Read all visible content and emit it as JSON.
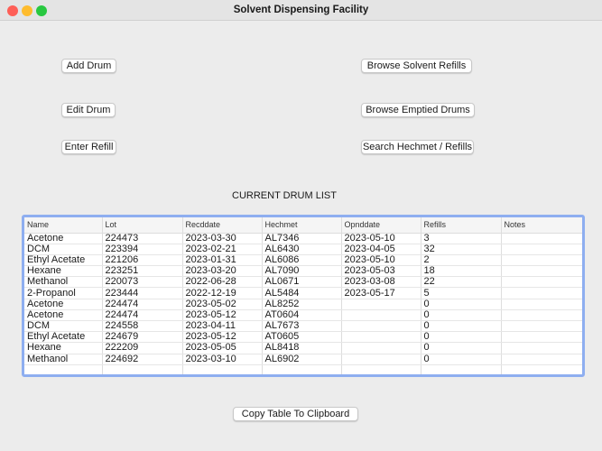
{
  "window": {
    "title": "Solvent Dispensing Facility"
  },
  "buttons": {
    "add_drum": "Add Drum",
    "edit_drum": "Edit Drum",
    "enter_refill": "Enter Refill",
    "browse_refills": "Browse Solvent Refills",
    "browse_emptied": "Browse Emptied Drums",
    "search": "Search Hechmet / Refills",
    "copy": "Copy Table To Clipboard"
  },
  "list_label": "CURRENT DRUM LIST",
  "table": {
    "columns": [
      "Name",
      "Lot",
      "Recddate",
      "Hechmet",
      "Opnddate",
      "Refills",
      "Notes"
    ],
    "rows": [
      [
        "Acetone",
        "224473",
        "2023-03-30",
        "AL7346",
        "2023-05-10",
        "3",
        ""
      ],
      [
        "DCM",
        "223394",
        "2023-02-21",
        "AL6430",
        "2023-04-05",
        "32",
        ""
      ],
      [
        "Ethyl Acetate",
        "221206",
        "2023-01-31",
        "AL6086",
        "2023-05-10",
        "2",
        ""
      ],
      [
        "Hexane",
        "223251",
        "2023-03-20",
        "AL7090",
        "2023-05-03",
        "18",
        ""
      ],
      [
        "Methanol",
        "220073",
        "2022-06-28",
        "AL0671",
        "2023-03-08",
        "22",
        ""
      ],
      [
        "2-Propanol",
        "223444",
        "2022-12-19",
        "AL5484",
        "2023-05-17",
        "5",
        ""
      ],
      [
        "Acetone",
        "224474",
        "2023-05-02",
        "AL8252",
        "",
        "0",
        ""
      ],
      [
        "Acetone",
        "224474",
        "2023-05-12",
        "AT0604",
        "",
        "0",
        ""
      ],
      [
        "DCM",
        "224558",
        "2023-04-11",
        "AL7673",
        "",
        "0",
        ""
      ],
      [
        "Ethyl Acetate",
        "224679",
        "2023-05-12",
        "AT0605",
        "",
        "0",
        ""
      ],
      [
        "Hexane",
        "222209",
        "2023-05-05",
        "AL8418",
        "",
        "0",
        ""
      ],
      [
        "Methanol",
        "224692",
        "2023-03-10",
        "AL6902",
        "",
        "0",
        ""
      ],
      [
        "",
        "",
        "",
        "",
        "",
        "",
        ""
      ]
    ]
  }
}
